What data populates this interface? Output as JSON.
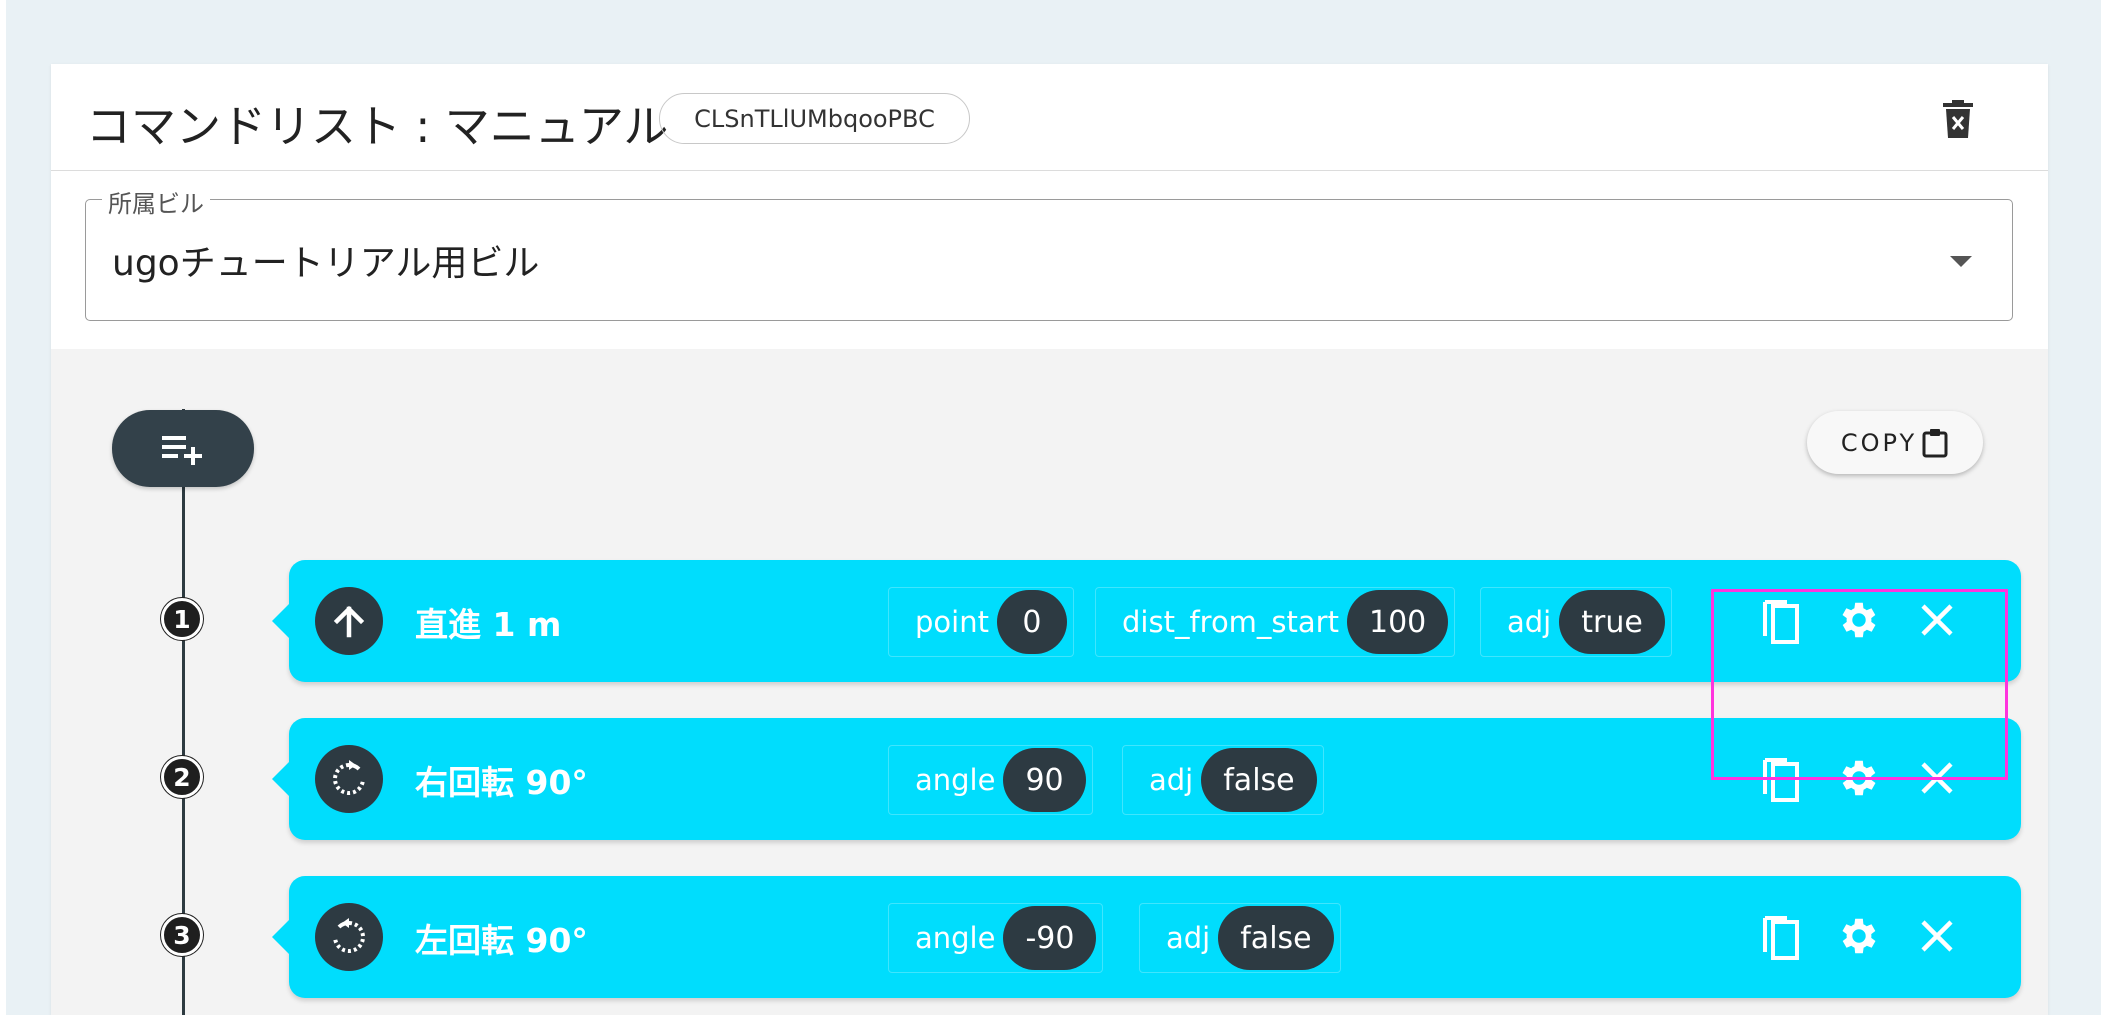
{
  "header": {
    "title": "コマンドリスト : マニュアル",
    "id_chip": "CLSnTLlUMbqooPBC"
  },
  "building": {
    "legend": "所属ビル",
    "value": "ugoチュートリアル用ビル"
  },
  "toolbar": {
    "copy_label": "COPY"
  },
  "commands": [
    {
      "number": "1",
      "title": "直進 1 m",
      "icon": "arrow-up-icon",
      "params": [
        {
          "label": "point",
          "value": "0"
        },
        {
          "label": "dist_from_start",
          "value": "100"
        },
        {
          "label": "adj",
          "value": "true"
        }
      ]
    },
    {
      "number": "2",
      "title": "右回転 90°",
      "icon": "rotate-right-icon",
      "params": [
        {
          "label": "angle",
          "value": "90"
        },
        {
          "label": "adj",
          "value": "false"
        }
      ]
    },
    {
      "number": "3",
      "title": "左回転 90°",
      "icon": "rotate-left-icon",
      "params": [
        {
          "label": "angle",
          "value": "-90"
        },
        {
          "label": "adj",
          "value": "false"
        }
      ]
    }
  ],
  "colors": {
    "command_card": "#00ddfd",
    "dark": "#2d3a42",
    "highlight": "#ff33dd"
  }
}
